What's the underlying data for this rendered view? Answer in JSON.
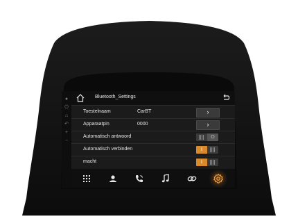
{
  "header": {
    "title": "Bluetooth_Settings"
  },
  "rows": [
    {
      "label": "Toestelnaam",
      "value": "CarBT",
      "control": "arrow"
    },
    {
      "label": "Apparaatpin",
      "value": "0000",
      "control": "arrow"
    },
    {
      "label": "Automatisch antwoord",
      "value": "",
      "control": "toggle",
      "state": "off"
    },
    {
      "label": "Automatisch verbinden",
      "value": "",
      "control": "toggle",
      "state": "on"
    },
    {
      "label": "macht",
      "value": "",
      "control": "toggle",
      "state": "on"
    }
  ],
  "controls": {
    "arrow_glyph": "›",
    "toggle_on_glyph": "I",
    "toggle_off_glyph": "O"
  },
  "nav": [
    {
      "icon": "apps-grid-icon"
    },
    {
      "icon": "contacts-icon"
    },
    {
      "icon": "phone-icon"
    },
    {
      "icon": "music-icon"
    },
    {
      "icon": "link-icon"
    },
    {
      "icon": "settings-gear-icon",
      "active": true
    }
  ],
  "colors": {
    "accent": "#d98a2b",
    "screen_bg": "#1b1b1b",
    "bezel": "#111111"
  }
}
